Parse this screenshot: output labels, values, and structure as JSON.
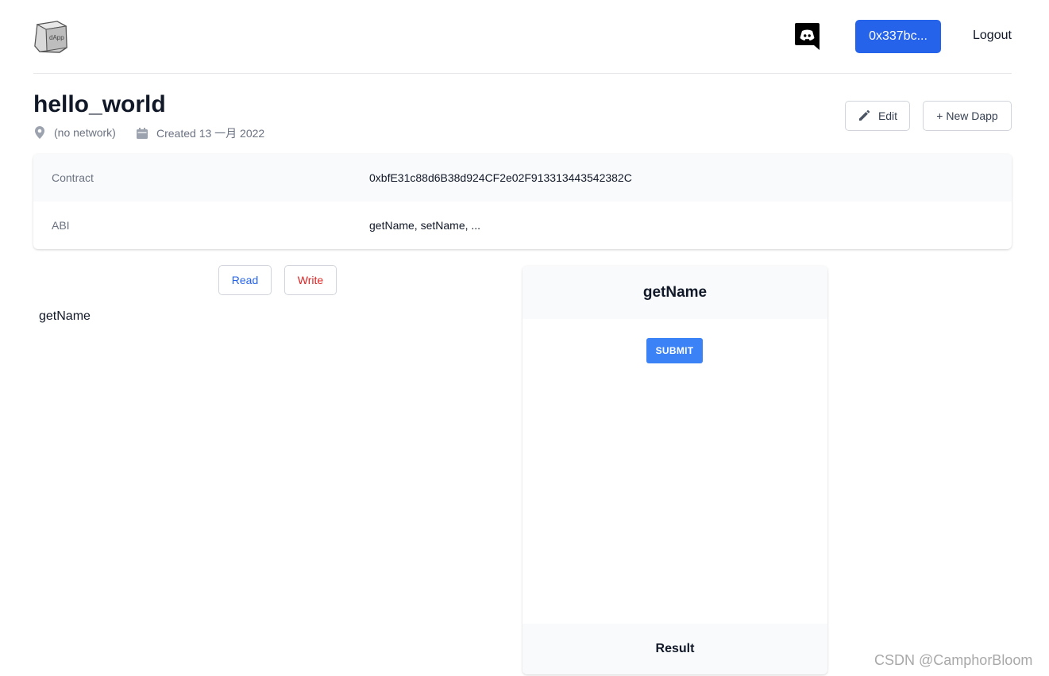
{
  "header": {
    "logo_text": "dApp",
    "account_label": "0x337bc...",
    "logout_label": "Logout",
    "icons": {
      "logo": "dapp-logo-icon",
      "chat": "discord-icon"
    }
  },
  "page": {
    "title": "hello_world",
    "network": "(no network)",
    "created": "Created 13 一月 2022",
    "edit_label": "Edit",
    "new_dapp_label": "+ New Dapp",
    "icons": {
      "network": "location-pin-icon",
      "created": "calendar-icon",
      "edit": "pencil-icon"
    }
  },
  "info": {
    "rows": [
      {
        "label": "Contract",
        "value": "0xbfE31c88d6B38d924CF2e02F913313443542382C"
      },
      {
        "label": "ABI",
        "value": "getName, setName, ..."
      }
    ]
  },
  "functions": {
    "read_label": "Read",
    "write_label": "Write",
    "items": [
      "getName"
    ]
  },
  "panel": {
    "title": "getName",
    "submit_label": "SUBMIT",
    "result_label": "Result"
  },
  "watermark": "CSDN @CamphorBloom",
  "colors": {
    "primary": "#2563eb",
    "submit": "#3b82f6",
    "write": "#dc2626",
    "muted": "#6b7280",
    "panel_bg": "#f9fafb"
  }
}
